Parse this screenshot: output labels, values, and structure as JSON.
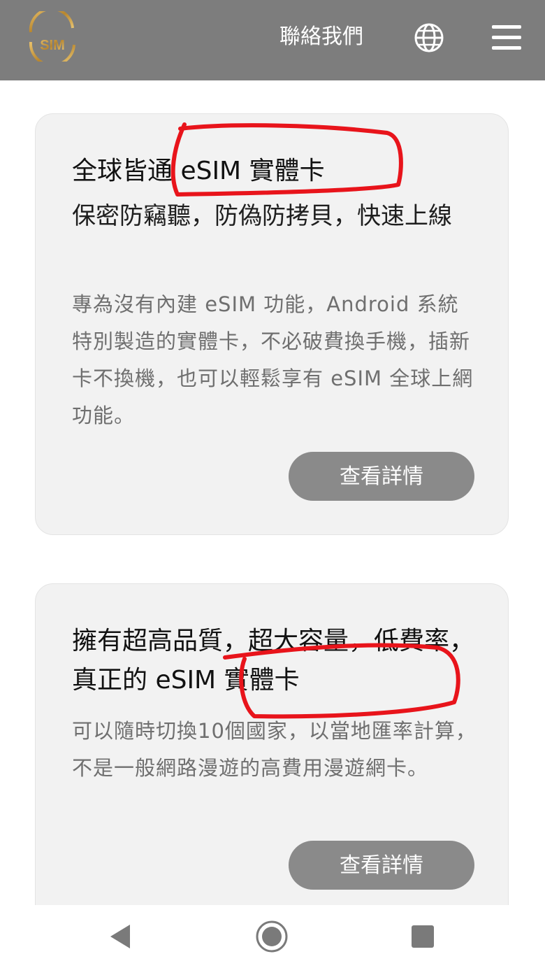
{
  "header": {
    "logo_text": "SIM",
    "contact_label": "聯絡我們",
    "globe_icon": "globe-icon",
    "menu_icon": "hamburger-menu-icon",
    "background_color": "#7d7d7d"
  },
  "cards": [
    {
      "title": "全球皆通 eSIM 實體卡",
      "subtitle": "保密防竊聽，防偽防拷貝，快速上線",
      "description": "專為沒有內建 eSIM 功能，Android 系統特別製造的實體卡，不必破費換手機，插新卡不換機，也可以輕鬆享有 eSIM 全球上網功能。",
      "button_label": "查看詳情"
    },
    {
      "title": "擁有超高品質，超大容量，低費率，真正的 eSIM 實體卡",
      "description": "可以隨時切換10個國家，以當地匯率計算，不是一般網路漫遊的高費用漫遊網卡。",
      "button_label": "查看詳情"
    }
  ],
  "annotation_color": "#e8141b",
  "navbar": {
    "back_icon": "back-triangle-icon",
    "home_icon": "home-circle-icon",
    "recent_icon": "recent-apps-square-icon"
  }
}
